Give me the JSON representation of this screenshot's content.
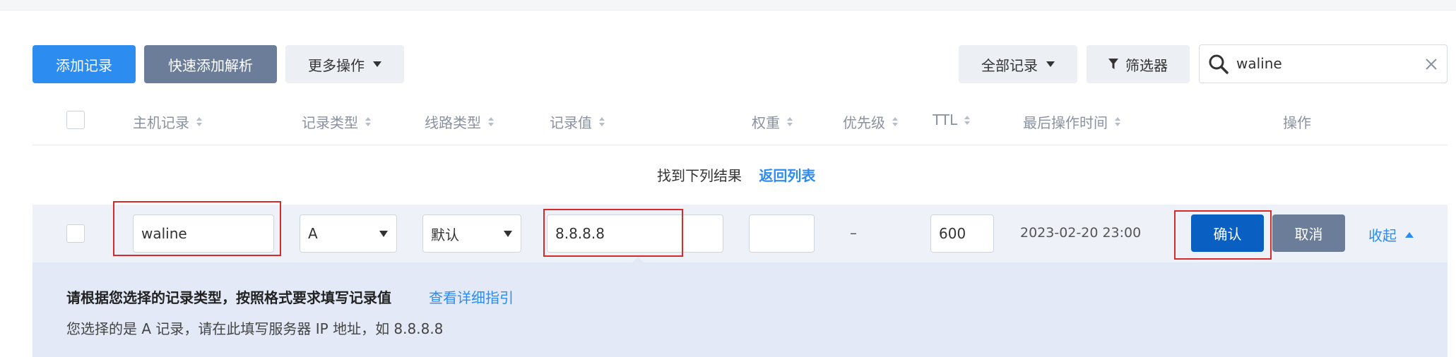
{
  "toolbar": {
    "add_record": "添加记录",
    "quick_add": "快速添加解析",
    "more_actions": "更多操作",
    "all_records": "全部记录",
    "filter": "筛选器"
  },
  "search": {
    "value": "waline",
    "icon": "search-icon",
    "clear_icon": "close-icon"
  },
  "table": {
    "headers": {
      "host": "主机记录",
      "record_type": "记录类型",
      "line_type": "线路类型",
      "record_value": "记录值",
      "weight": "权重",
      "priority": "优先级",
      "ttl": "TTL",
      "last_modified": "最后操作时间",
      "actions": "操作"
    },
    "result_text": "找到下列结果",
    "back_to_list": "返回列表"
  },
  "edit_row": {
    "host": "waline",
    "record_type": "A",
    "line_type": "默认",
    "record_value": "8.8.8.8",
    "weight": "",
    "priority": "–",
    "ttl": "600",
    "last_modified": "2023-02-20 23:00",
    "confirm": "确认",
    "cancel": "取消",
    "collapse": "收起"
  },
  "hint": {
    "title": "请根据您选择的记录类型，按照格式要求填写记录值",
    "guide_link": "查看详细指引",
    "text": "您选择的是 A 记录，请在此填写服务器 IP 地址，如 8.8.8.8"
  },
  "colors": {
    "primary": "#2d8cf0",
    "confirm": "#0a5fc2",
    "secondary": "#6b7d99",
    "highlight": "#d62b2b"
  }
}
